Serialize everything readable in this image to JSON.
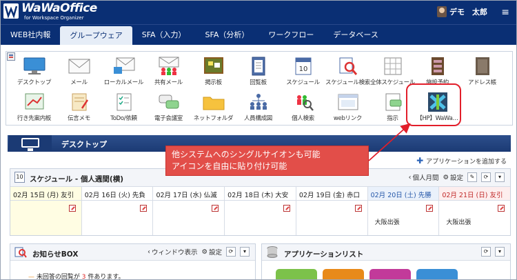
{
  "header": {
    "logo_main": "WaWaOffice",
    "logo_sub": "for Workspace Organizer",
    "user_name": "デモ　太郎",
    "menu_icon": "≡"
  },
  "nav": {
    "items": [
      {
        "label": "WEB社内報",
        "active": false
      },
      {
        "label": "グループウェア",
        "active": true
      },
      {
        "label": "SFA（入力）",
        "active": false
      },
      {
        "label": "SFA（分析）",
        "active": false
      },
      {
        "label": "ワークフロー",
        "active": false
      },
      {
        "label": "データベース",
        "active": false
      }
    ]
  },
  "apps": {
    "row1": [
      {
        "label": "デスクトップ",
        "icon": "monitor-icon"
      },
      {
        "label": "メール",
        "icon": "mail-icon"
      },
      {
        "label": "ローカルメール",
        "icon": "local-mail-icon"
      },
      {
        "label": "共有メール",
        "icon": "shared-mail-icon"
      },
      {
        "label": "掲示板",
        "icon": "bulletin-board-icon"
      },
      {
        "label": "回覧板",
        "icon": "circular-board-icon"
      },
      {
        "label": "スケジュール",
        "icon": "calendar-icon"
      },
      {
        "label": "スケジュール検索",
        "icon": "schedule-search-icon"
      },
      {
        "label": "全体スケジュール",
        "icon": "all-schedule-icon"
      },
      {
        "label": "施設予約",
        "icon": "facility-icon"
      },
      {
        "label": "アドレス帳",
        "icon": "address-book-icon"
      }
    ],
    "row2": [
      {
        "label": "行き先案内板",
        "icon": "destination-icon"
      },
      {
        "label": "伝言メモ",
        "icon": "memo-icon"
      },
      {
        "label": "ToDo/依頼",
        "icon": "todo-icon"
      },
      {
        "label": "電子会議室",
        "icon": "meeting-icon"
      },
      {
        "label": "ネットフォルダ",
        "icon": "folder-icon"
      },
      {
        "label": "人員構成図",
        "icon": "org-chart-icon"
      },
      {
        "label": "個人検索",
        "icon": "person-search-icon"
      },
      {
        "label": "webリンク",
        "icon": "web-link-icon"
      },
      {
        "label": "指示",
        "icon": "instruction-icon"
      },
      {
        "label": "【HP】WaWa…",
        "icon": "hp-link-icon"
      }
    ]
  },
  "desktop": {
    "title": "デスクトップ",
    "add_app": "アプリケーションを追加する"
  },
  "callout": {
    "line1": "他システムへのシングルサイオンも可能",
    "line2": "アイコンを自由に貼り付け可能"
  },
  "schedule": {
    "cal_day": "10",
    "title": "スケジュール - 個人週間(横)",
    "tool_personal_month": "個人月間",
    "tool_settings": "設定",
    "days": [
      {
        "label": "02月 15日 (月) 友引",
        "kind": "today",
        "event": ""
      },
      {
        "label": "02月 16日 (火) 先負",
        "kind": "",
        "event": ""
      },
      {
        "label": "02月 17日 (水) 仏滅",
        "kind": "",
        "event": ""
      },
      {
        "label": "02月 18日 (木) 大安",
        "kind": "",
        "event": ""
      },
      {
        "label": "02月 19日 (金) 赤口",
        "kind": "",
        "event": ""
      },
      {
        "label": "02月 20日 (土) 先勝",
        "kind": "sat",
        "event": "大阪出張"
      },
      {
        "label": "02月 21日 (日) 友引",
        "kind": "sun",
        "event": "大阪出張"
      }
    ]
  },
  "notice": {
    "title": "お知らせBOX",
    "window_label": "ウィンドウ表示",
    "settings_label": "設定",
    "message_pre": "未回答の回覧が",
    "count": "3",
    "message_post": "件あります。"
  },
  "applist": {
    "title": "アプリケーションリスト"
  },
  "colors": {
    "brand": "#0a2f74",
    "highlight": "#e21e2a",
    "callout_bg": "#e24e49"
  }
}
